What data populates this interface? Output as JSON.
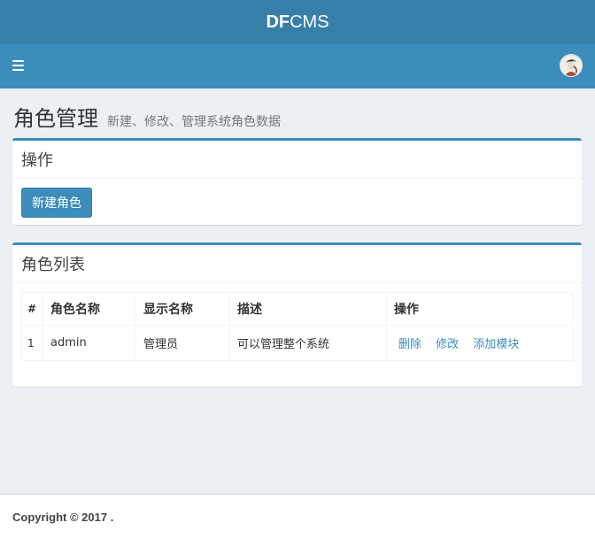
{
  "header": {
    "logo_bold": "DF",
    "logo_light": "CMS"
  },
  "page": {
    "title": "角色管理",
    "subtitle": "新建、修改、管理系统角色数据"
  },
  "actions_box": {
    "title": "操作",
    "new_role_label": "新建角色"
  },
  "list_box": {
    "title": "角色列表",
    "columns": [
      "#",
      "角色名称",
      "显示名称",
      "描述",
      "操作"
    ],
    "rows": [
      {
        "num": "1",
        "role_name": "admin",
        "display_name": "管理员",
        "description": "可以管理整个系统",
        "ops": [
          "删除",
          "修改",
          "添加模块"
        ]
      }
    ]
  },
  "footer": {
    "copyright": "Copyright © 2017 ."
  },
  "colors": {
    "logo_bg": "#367fa9",
    "nav_bg": "#3c8dbc",
    "page_bg": "#ecf0f5",
    "link": "#3c8dbc"
  }
}
